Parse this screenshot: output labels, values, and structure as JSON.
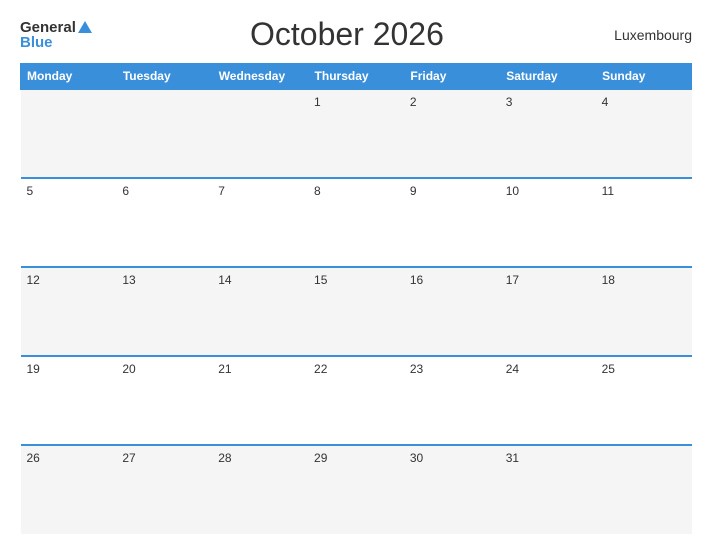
{
  "header": {
    "logo_general": "General",
    "logo_blue": "Blue",
    "title": "October 2026",
    "country": "Luxembourg"
  },
  "days_of_week": [
    "Monday",
    "Tuesday",
    "Wednesday",
    "Thursday",
    "Friday",
    "Saturday",
    "Sunday"
  ],
  "weeks": [
    [
      "",
      "",
      "",
      "1",
      "2",
      "3",
      "4"
    ],
    [
      "5",
      "6",
      "7",
      "8",
      "9",
      "10",
      "11"
    ],
    [
      "12",
      "13",
      "14",
      "15",
      "16",
      "17",
      "18"
    ],
    [
      "19",
      "20",
      "21",
      "22",
      "23",
      "24",
      "25"
    ],
    [
      "26",
      "27",
      "28",
      "29",
      "30",
      "31",
      ""
    ]
  ]
}
